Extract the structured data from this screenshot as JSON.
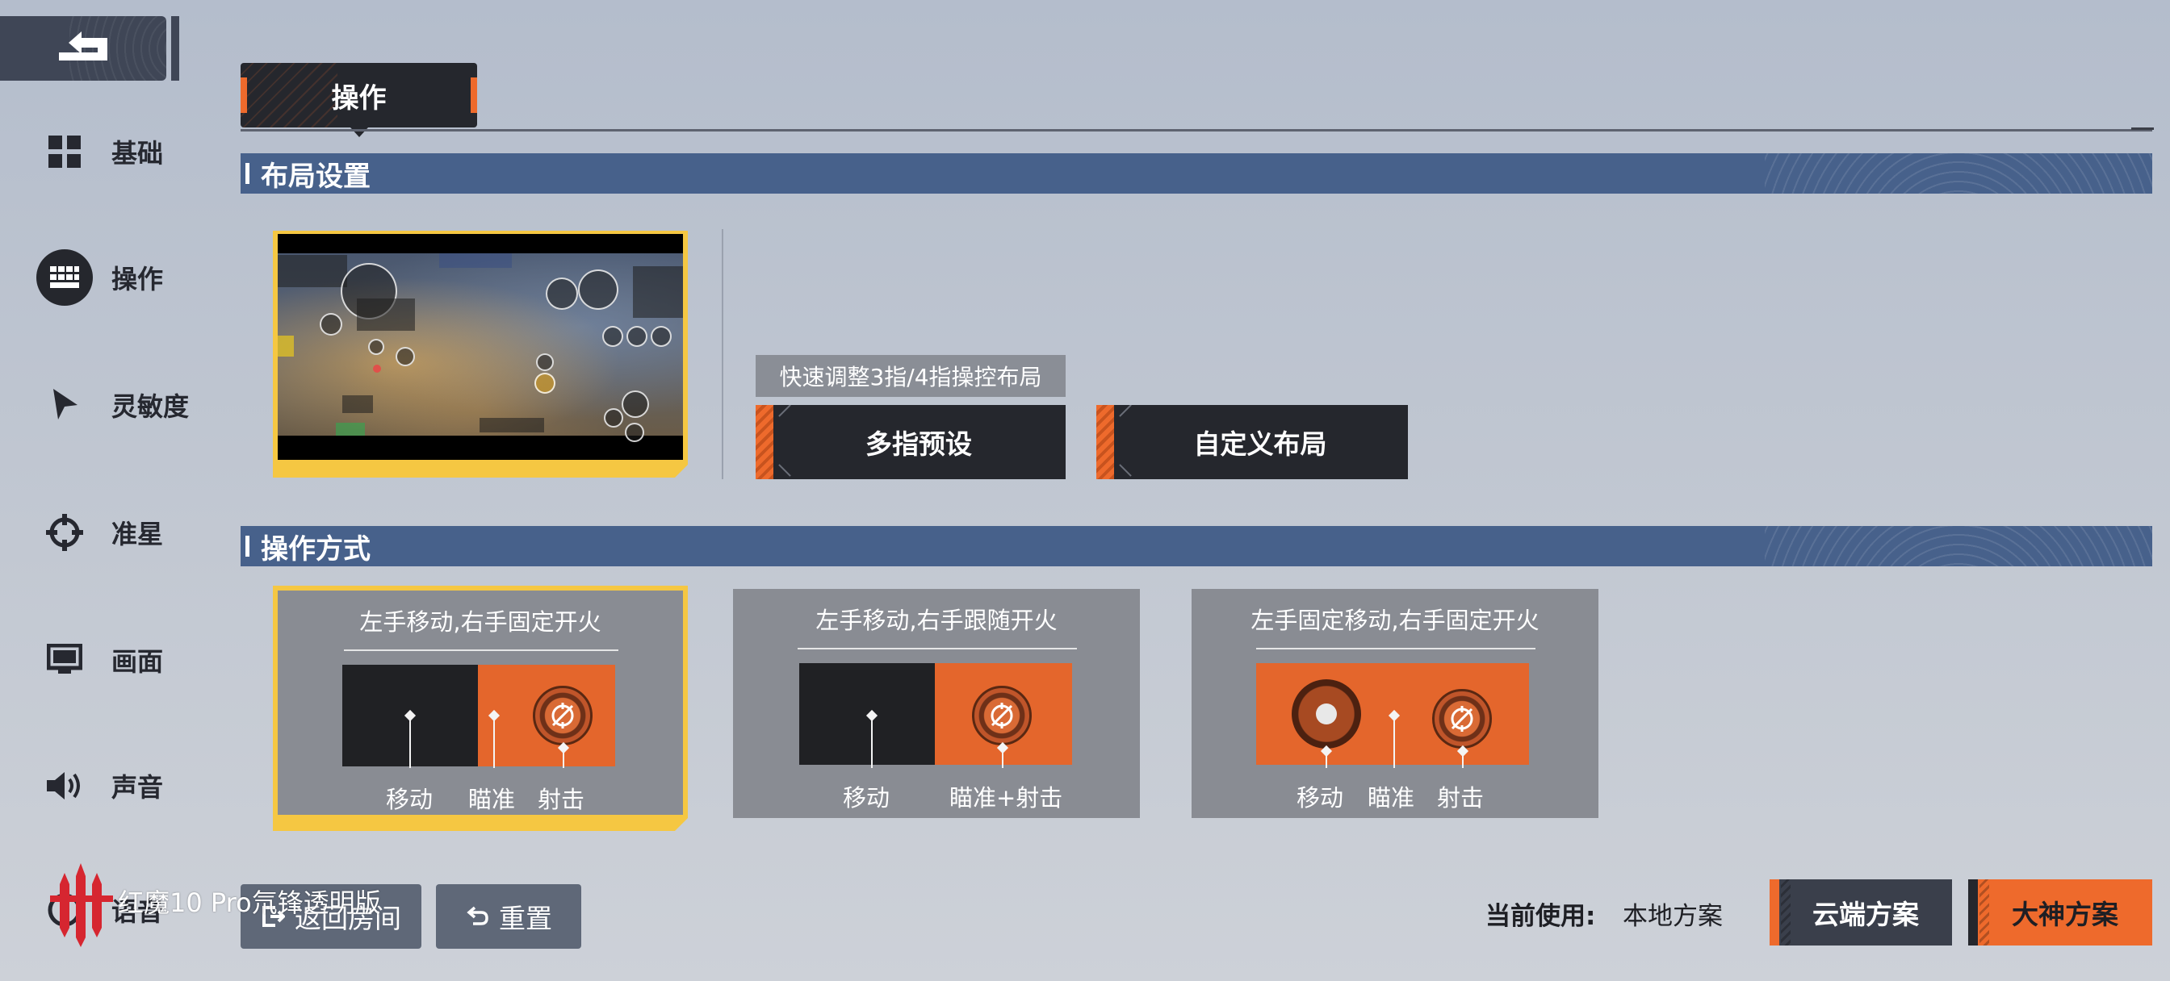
{
  "colors": {
    "accent_orange": "#ee6a2c",
    "selected_yellow": "#f5c742",
    "section_blue": "#47618b",
    "dark": "#25272d"
  },
  "sidebar": {
    "back_icon": "return-arrow-icon",
    "items": [
      {
        "label": "基础",
        "icon": "grid-icon",
        "active": false
      },
      {
        "label": "操作",
        "icon": "keyboard-icon",
        "active": true
      },
      {
        "label": "灵敏度",
        "icon": "cursor-arrow-icon",
        "active": false
      },
      {
        "label": "准星",
        "icon": "crosshair-icon",
        "active": false
      },
      {
        "label": "画面",
        "icon": "monitor-icon",
        "active": false
      },
      {
        "label": "声音",
        "icon": "speaker-icon",
        "active": false
      },
      {
        "label": "语音",
        "icon": "voice-icon",
        "active": false
      }
    ]
  },
  "tabs": {
    "active_label": "操作"
  },
  "layout_section": {
    "title": "布局设置",
    "hint": "快速调整3指/4指操控布局",
    "multi_finger_button": "多指预设",
    "custom_layout_button": "自定义布局"
  },
  "mode_section": {
    "title": "操作方式",
    "modes": [
      {
        "title": "左手移动,右手固定开火",
        "labels": [
          "移动",
          "瞄准",
          "射击"
        ],
        "selected": true
      },
      {
        "title": "左手移动,右手跟随开火",
        "labels": [
          "移动",
          "瞄准+射击"
        ],
        "selected": false
      },
      {
        "title": "左手固定移动,右手固定开火",
        "labels": [
          "移动",
          "瞄准",
          "射击"
        ],
        "selected": false
      }
    ]
  },
  "footer": {
    "watermark": "红魔10 Pro氘锋透明版",
    "back_room_button": "返回房间",
    "reset_button": "重置",
    "current_label": "当前使用:",
    "current_value": "本地方案",
    "cloud_button": "云端方案",
    "master_button": "大神方案"
  }
}
